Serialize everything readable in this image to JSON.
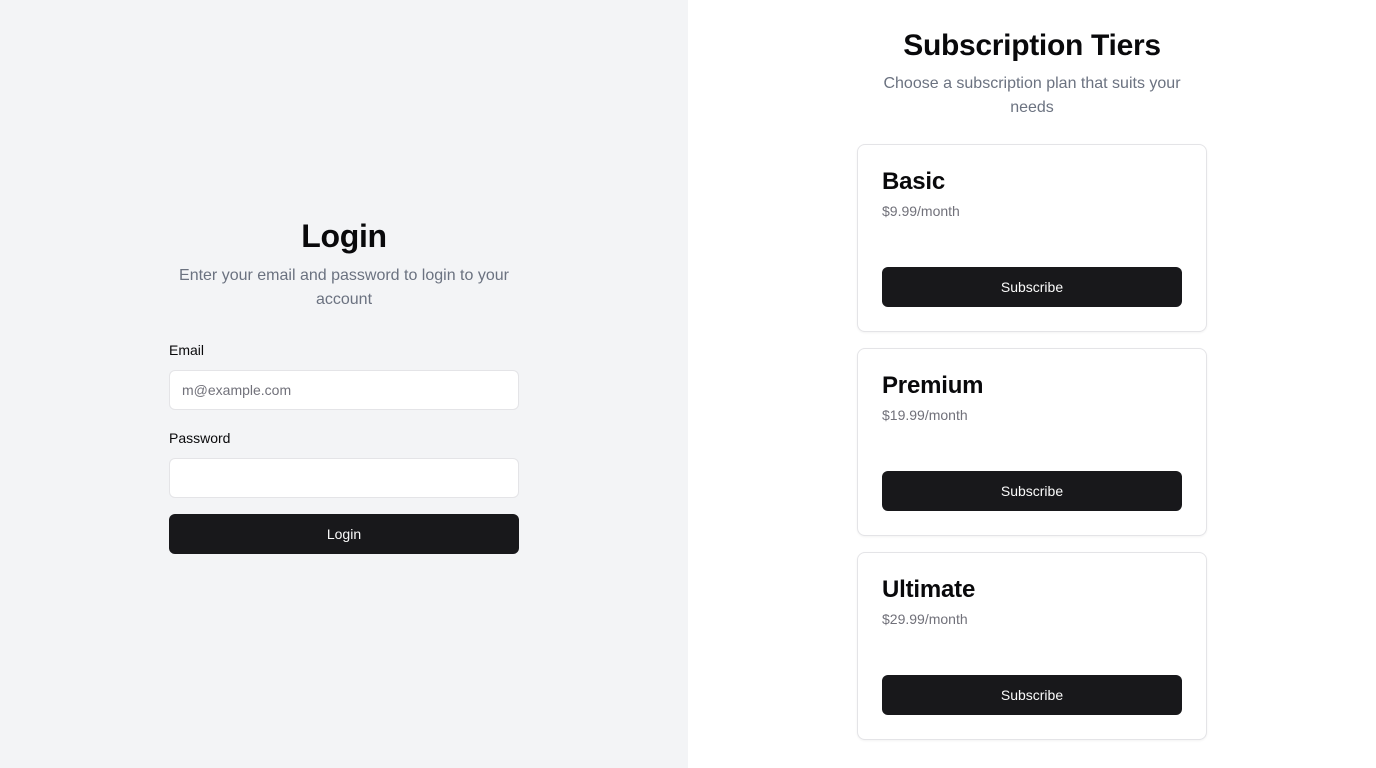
{
  "login": {
    "title": "Login",
    "subtitle": "Enter your email and password to login to your account",
    "email_label": "Email",
    "email_placeholder": "m@example.com",
    "email_value": "",
    "password_label": "Password",
    "password_value": "",
    "button_label": "Login"
  },
  "subscriptions": {
    "title": "Subscription Tiers",
    "subtitle": "Choose a subscription plan that suits your needs",
    "tiers": [
      {
        "name": "Basic",
        "price": "$9.99/month",
        "button_label": "Subscribe"
      },
      {
        "name": "Premium",
        "price": "$19.99/month",
        "button_label": "Subscribe"
      },
      {
        "name": "Ultimate",
        "price": "$29.99/month",
        "button_label": "Subscribe"
      }
    ]
  },
  "colors": {
    "left_background": "#f3f4f6",
    "right_background": "#ffffff",
    "button_background": "#18181b",
    "muted_text": "#6b7280",
    "border": "#e4e4e7"
  }
}
